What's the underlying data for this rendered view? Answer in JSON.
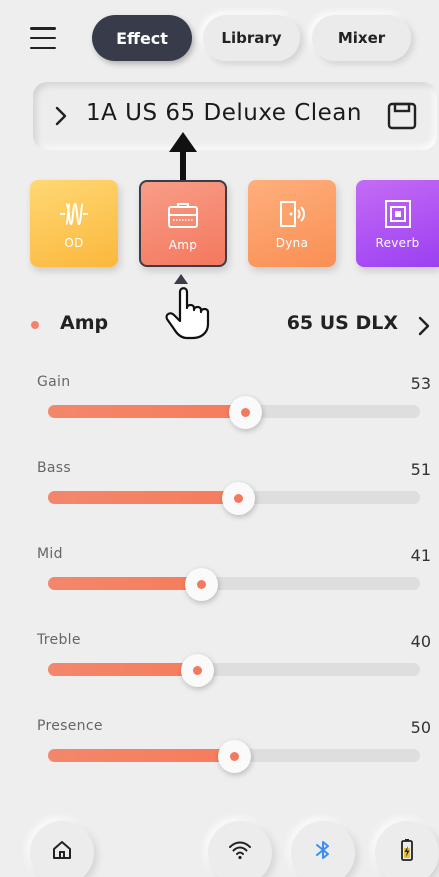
{
  "header": {
    "tabs": [
      {
        "label": "Effect",
        "active": true
      },
      {
        "label": "Library",
        "active": false
      },
      {
        "label": "Mixer",
        "active": false
      }
    ]
  },
  "preset": {
    "name": "1A  US 65 Deluxe Clean"
  },
  "modules": [
    {
      "label": "OD",
      "color": "#fbb73c",
      "icon": "od-wave-icon"
    },
    {
      "label": "Amp",
      "color": "#f4785e",
      "icon": "amp-icon",
      "selected": true
    },
    {
      "label": "Dyna",
      "color": "#f98f54",
      "icon": "dyna-door-icon"
    },
    {
      "label": "Reverb",
      "color": "#9c3ff2",
      "icon": "reverb-square-icon"
    }
  ],
  "amp": {
    "title": "Amp",
    "model": "65 US DLX"
  },
  "params": [
    {
      "label": "Gain",
      "value": "53",
      "level": 0.53
    },
    {
      "label": "Bass",
      "value": "51",
      "level": 0.51
    },
    {
      "label": "Mid",
      "value": "41",
      "level": 0.41
    },
    {
      "label": "Treble",
      "value": "40",
      "level": 0.4
    },
    {
      "label": "Presence",
      "value": "50",
      "level": 0.5
    }
  ],
  "colors": {
    "accent": "#f4785e",
    "active_tab": "#383c4a",
    "bluetooth": "#3a8ef0",
    "battery": "#e7c234"
  },
  "bottom_bar": [
    "home-icon",
    "wifi-icon",
    "bluetooth-icon",
    "battery-charging-icon"
  ]
}
